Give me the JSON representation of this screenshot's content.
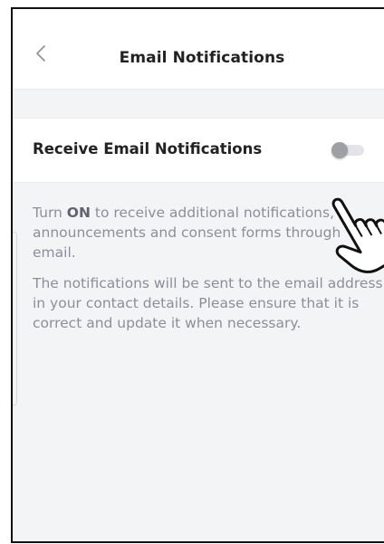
{
  "header": {
    "back_icon": "chevron-left-icon",
    "title": "Email Notifications"
  },
  "setting": {
    "label": "Receive Email Notifications",
    "toggle_state": "off",
    "toggle_icon": "toggle-switch-icon"
  },
  "description": {
    "para1_prefix": "Turn ",
    "para1_bold": "ON",
    "para1_suffix": " to receive additional notifications, announcements and consent forms through email.",
    "para2": "The notifications will be sent to the email address in your contact details. Please ensure that it is correct and update it when necessary."
  },
  "overlay": {
    "pointer_icon": "pointing-hand-icon"
  },
  "colors": {
    "background": "#f3f4f6",
    "card": "#ffffff",
    "title_text": "#222222",
    "body_text": "#8a8f99",
    "toggle_knob": "#9ea0a6",
    "toggle_track": "#e4e4e8"
  }
}
